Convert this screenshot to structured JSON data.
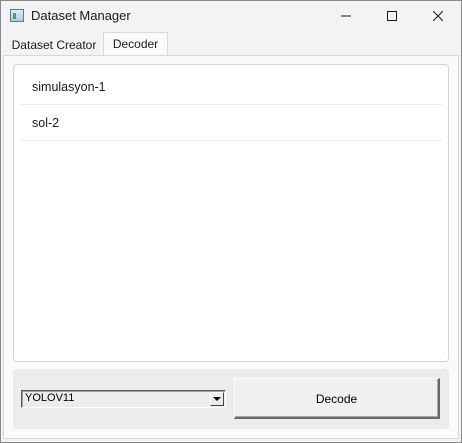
{
  "window": {
    "title": "Dataset Manager",
    "minimize_icon": "minimize-icon",
    "maximize_icon": "maximize-icon",
    "close_icon": "close-icon",
    "app_icon": "app-icon"
  },
  "tabs": [
    {
      "label": "Dataset Creator",
      "active": false
    },
    {
      "label": "Decoder",
      "active": true
    }
  ],
  "decoder": {
    "items": [
      {
        "label": "simulasyon-1"
      },
      {
        "label": "sol-2"
      }
    ],
    "model_select": {
      "value": "YOLOV11"
    },
    "decode_label": "Decode"
  }
}
